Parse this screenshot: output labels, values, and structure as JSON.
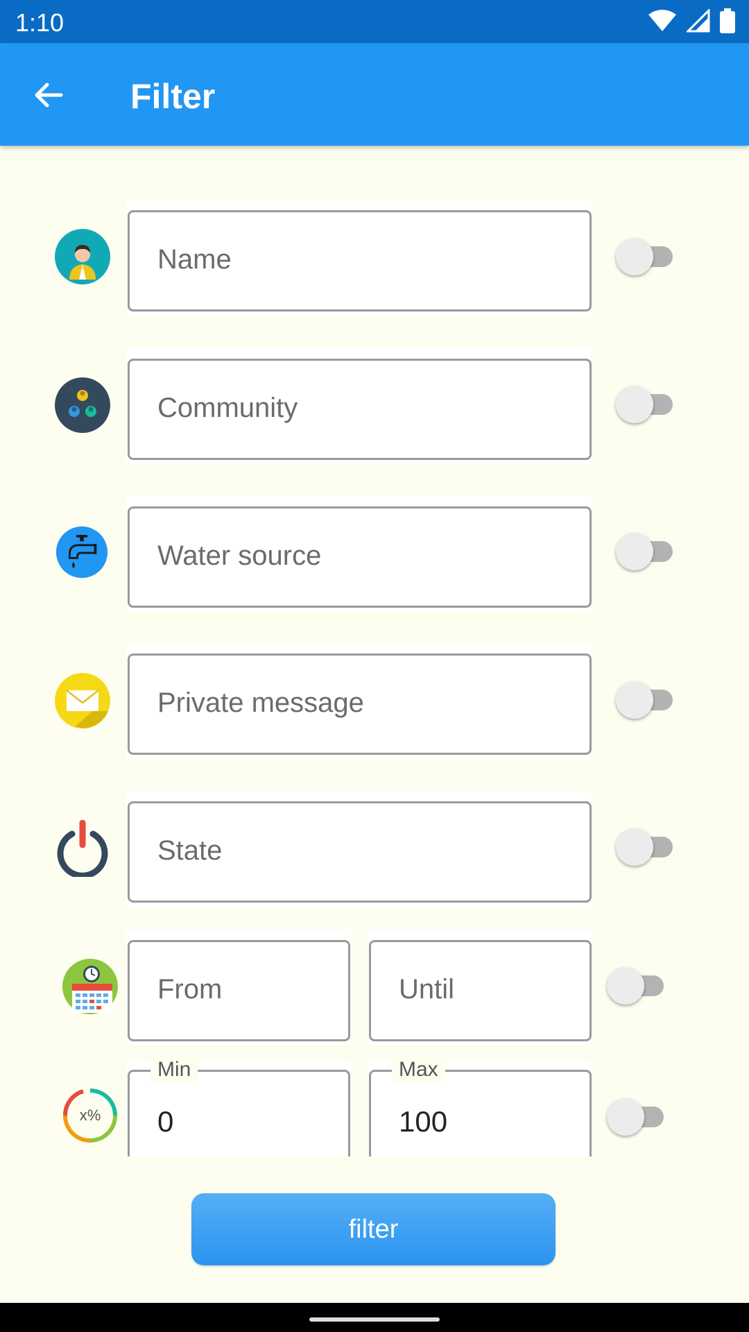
{
  "status_bar": {
    "time": "1:10"
  },
  "app_bar": {
    "title": "Filter",
    "back_icon": "arrow-left-icon"
  },
  "filters": [
    {
      "icon": "person-icon",
      "placeholder": "Name",
      "enabled": false
    },
    {
      "icon": "community-icon",
      "placeholder": "Community",
      "enabled": false
    },
    {
      "icon": "water-tap-icon",
      "placeholder": "Water source",
      "enabled": false
    },
    {
      "icon": "envelope-icon",
      "placeholder": "Private message",
      "enabled": false
    },
    {
      "icon": "power-icon",
      "placeholder": "State",
      "enabled": false
    }
  ],
  "date_range": {
    "icon": "calendar-clock-icon",
    "from_placeholder": "From",
    "until_placeholder": "Until",
    "enabled": false
  },
  "percent_range": {
    "icon": "percent-gauge-icon",
    "icon_text": "x%",
    "min_label": "Min",
    "min_value": "0",
    "max_label": "Max",
    "max_value": "100",
    "enabled": false
  },
  "filter_button": {
    "label": "filter"
  },
  "colors": {
    "status_bar": "#0a6bc4",
    "app_bar": "#2196f3",
    "background": "#fefef0",
    "button": "#3da2f3"
  }
}
